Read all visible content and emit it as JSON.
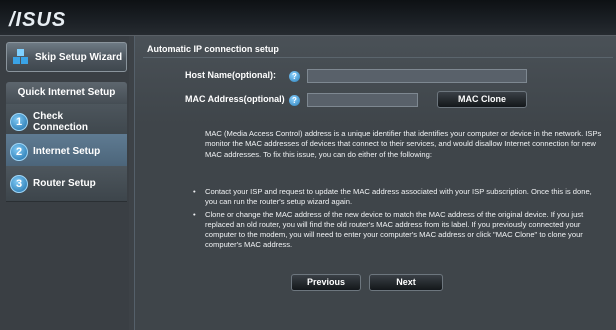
{
  "header": {
    "logo": "/ISUS"
  },
  "sidebar": {
    "skip_label": "Skip Setup Wizard",
    "section_title": "Quick Internet Setup",
    "steps": [
      {
        "num": "1",
        "label": "Check Connection"
      },
      {
        "num": "2",
        "label": "Internet Setup"
      },
      {
        "num": "3",
        "label": "Router Setup"
      }
    ]
  },
  "main": {
    "title": "Automatic IP connection setup",
    "host_label": "Host Name(optional):",
    "host_value": "",
    "mac_label": "MAC Address(optional)",
    "mac_value": "",
    "help_glyph": "?",
    "mac_clone_label": "MAC Clone",
    "description": "MAC (Media Access Control) address is a unique identifier that identifies your computer or device in the network. ISPs monitor the MAC addresses of devices that connect to their services, and would disallow Internet connection for new MAC addresses. To fix this issue, you can do either of the following:",
    "bullets": [
      "Contact your ISP and request to update the MAC address associated with your ISP subscription. Once this is done, you can run the router's setup wizard again.",
      "Clone or change the MAC address of the new device to match the MAC address of the original device. If you just replaced an old router, you will find the old router's MAC address from its label. If you previously connected your computer to the modem, you will need to enter your computer's MAC address or click \"MAC Clone\" to clone your computer's MAC address."
    ],
    "previous_label": "Previous",
    "next_label": "Next"
  }
}
